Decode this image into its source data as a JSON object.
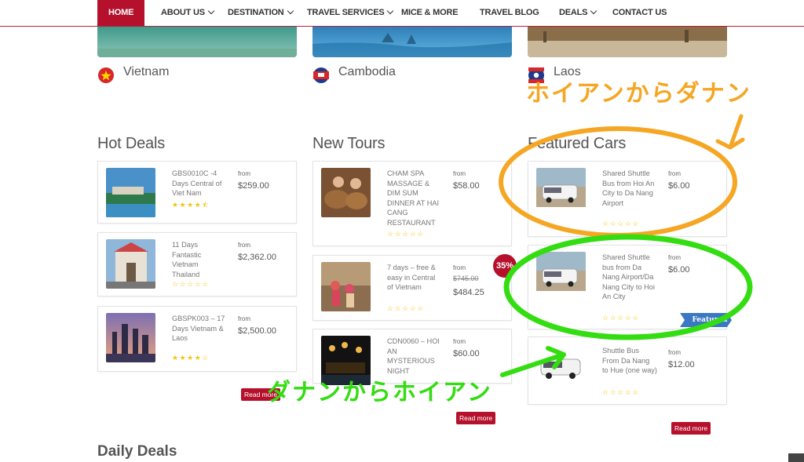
{
  "nav": {
    "items": [
      {
        "label": "HOME",
        "dropdown": false,
        "active": true
      },
      {
        "label": "ABOUT US",
        "dropdown": true
      },
      {
        "label": "DESTINATION",
        "dropdown": true
      },
      {
        "label": "TRAVEL SERVICES",
        "dropdown": true
      },
      {
        "label": "MICE & MORE",
        "dropdown": false
      },
      {
        "label": "TRAVEL BLOG",
        "dropdown": false
      },
      {
        "label": "DEALS",
        "dropdown": true
      },
      {
        "label": "CONTACT US",
        "dropdown": false
      }
    ]
  },
  "countries": [
    {
      "name": "Vietnam",
      "flag_color": "#d62828"
    },
    {
      "name": "Cambodia",
      "flag_color": "#1e3a8a"
    },
    {
      "name": "Laos",
      "flag_color": "#1e3a8a"
    }
  ],
  "sections": {
    "hot_deals": "Hot Deals",
    "new_tours": "New Tours",
    "featured_cars": "Featured Cars",
    "daily_deals": "Daily Deals"
  },
  "hot_deals": [
    {
      "title": "GBS0010C -4 Days Central of Viet Nam",
      "from": "from",
      "price": "$259.00",
      "stars": "★★★★⯪"
    },
    {
      "title": "11 Days Fantastic Vietnam Thailand",
      "from": "from",
      "price": "$2,362.00",
      "stars": "☆☆☆☆☆"
    },
    {
      "title": "GBSPK003 – 17 Days Vietnam & Laos",
      "from": "from",
      "price": "$2,500.00",
      "stars": "★★★★☆"
    }
  ],
  "new_tours": [
    {
      "title": "CHAM SPA MASSAGE & DIM SUM DINNER AT HAI CANG RESTAURANT",
      "from": "from",
      "price": "$58.00",
      "stars": "☆☆☆☆☆"
    },
    {
      "title": "7 days – free & easy in Central of Vietnam",
      "from": "from",
      "old_price": "$745.00",
      "price": "$484.25",
      "stars": "☆☆☆☆☆",
      "badge": "35%"
    },
    {
      "title": "CDN0060 – HOI AN MYSTERIOUS NIGHT",
      "from": "from",
      "price": "$60.00",
      "stars": "☆☆☆☆☆"
    }
  ],
  "featured_cars": [
    {
      "title": "Shared Shuttle Bus from Hoi An City to Da Nang Airport",
      "from": "from",
      "price": "$6.00",
      "stars": "☆☆☆☆☆"
    },
    {
      "title": "Shared Shuttle bus from Da Nang Airport/Da Nang City to Hoi An City",
      "from": "from",
      "price": "$6.00",
      "stars": "☆☆☆☆☆",
      "ribbon": "Featured"
    },
    {
      "title": "Shuttle Bus From Da Nang to Hue (one way)",
      "from": "from",
      "price": "$12.00",
      "stars": "☆☆☆☆☆"
    }
  ],
  "read_more": "Read more",
  "annotations": {
    "orange_text": "ホイアンからダナン",
    "green_text": "ダナンからホイアン",
    "orange_color": "#f5a623",
    "green_color": "#33dd11"
  },
  "colors": {
    "brand": "#b5112c",
    "star": "#f1c40f",
    "ribbon": "#3b78c3"
  }
}
